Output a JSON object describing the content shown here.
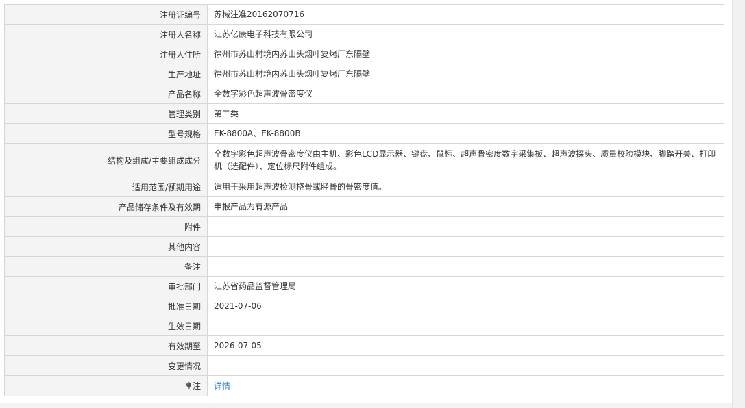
{
  "rows": [
    {
      "label": "注册证编号",
      "value": "苏械注准20162070716"
    },
    {
      "label": "注册人名称",
      "value": "江苏亿康电子科技有限公司"
    },
    {
      "label": "注册人住所",
      "value": "徐州市苏山村境内苏山头烟叶复烤厂东隔壁"
    },
    {
      "label": "生产地址",
      "value": "徐州市苏山村境内苏山头烟叶复烤厂东隔壁"
    },
    {
      "label": "产品名称",
      "value": "全数字彩色超声波骨密度仪"
    },
    {
      "label": "管理类别",
      "value": "第二类"
    },
    {
      "label": "型号规格",
      "value": "EK-8800A、EK-8800B"
    },
    {
      "label": "结构及组成/主要组成成分",
      "value": "全数字彩色超声波骨密度仪由主机、彩色LCD显示器、键盘、鼠标、超声骨密度数字采集板、超声波探头、质量校验模块、脚踏开关、打印机（选配件）、定位标尺附件组成。"
    },
    {
      "label": "适用范围/预期用途",
      "value": "适用于采用超声波检测桡骨或胫骨的骨密度值。"
    },
    {
      "label": "产品储存条件及有效期",
      "value": "申报产品为有源产品"
    },
    {
      "label": "附件",
      "value": ""
    },
    {
      "label": "其他内容",
      "value": ""
    },
    {
      "label": "备注",
      "value": ""
    },
    {
      "label": "审批部门",
      "value": "江苏省药品监督管理局"
    },
    {
      "label": "批准日期",
      "value": "2021-07-06"
    },
    {
      "label": "生效日期",
      "value": ""
    },
    {
      "label": "有效期至",
      "value": "2026-07-05"
    },
    {
      "label": "变更情况",
      "value": ""
    }
  ],
  "note": {
    "label": "注",
    "icon": "lightbulb-icon",
    "link_text": "详情"
  },
  "colors": {
    "label_bg": "#f4f4f4",
    "border": "#d7d7d7",
    "link": "#2a82d2",
    "text": "#333333"
  }
}
